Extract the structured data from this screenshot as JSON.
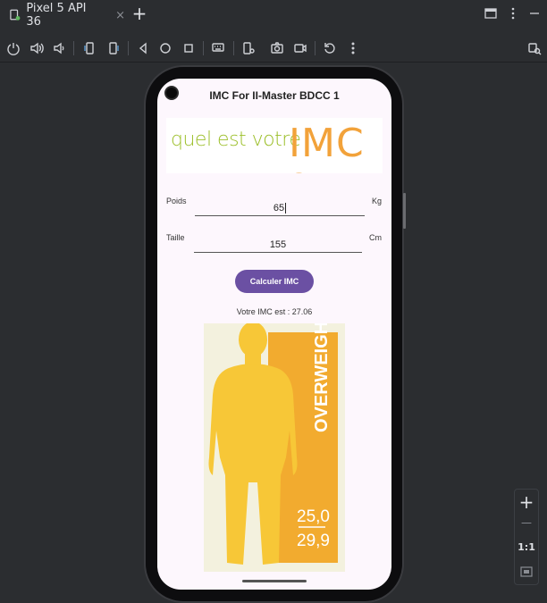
{
  "window": {
    "tab_title": "Pixel 5 API 36",
    "tab_close": "×",
    "new_tab": "+"
  },
  "toolbar": {
    "icons": [
      "power-icon",
      "volume-up-icon",
      "volume-down-icon",
      "rotate-left-icon",
      "rotate-right-icon",
      "back-icon",
      "home-icon",
      "overview-icon",
      "keyboard-icon",
      "screenshot-settings-icon",
      "camera-icon",
      "video-icon",
      "reset-icon",
      "more-icon",
      "device-explorer-icon"
    ]
  },
  "app": {
    "title": "IMC For II-Master BDCC 1",
    "banner": {
      "part1": "quel est votre",
      "part2": "IMC ?"
    },
    "weight": {
      "label": "Poids",
      "value": "65",
      "unit": "Kg"
    },
    "height": {
      "label": "Taille",
      "value": "155",
      "unit": "Cm"
    },
    "button": "Calculer IMC",
    "result": "Votre IMC est : 27.06",
    "figure": {
      "category": "OVERWEIGHT",
      "range_low": "25,0",
      "range_high": "29,9"
    }
  },
  "zoom": {
    "zoom_in": "+",
    "zoom_out": "—",
    "ratio": "1:1"
  },
  "colors": {
    "accent": "#6b50a3",
    "banner_green": "#9cbf2a",
    "banner_orange": "#f2a23a",
    "overweight": "#f2ab2f",
    "body": "#f7c737"
  }
}
